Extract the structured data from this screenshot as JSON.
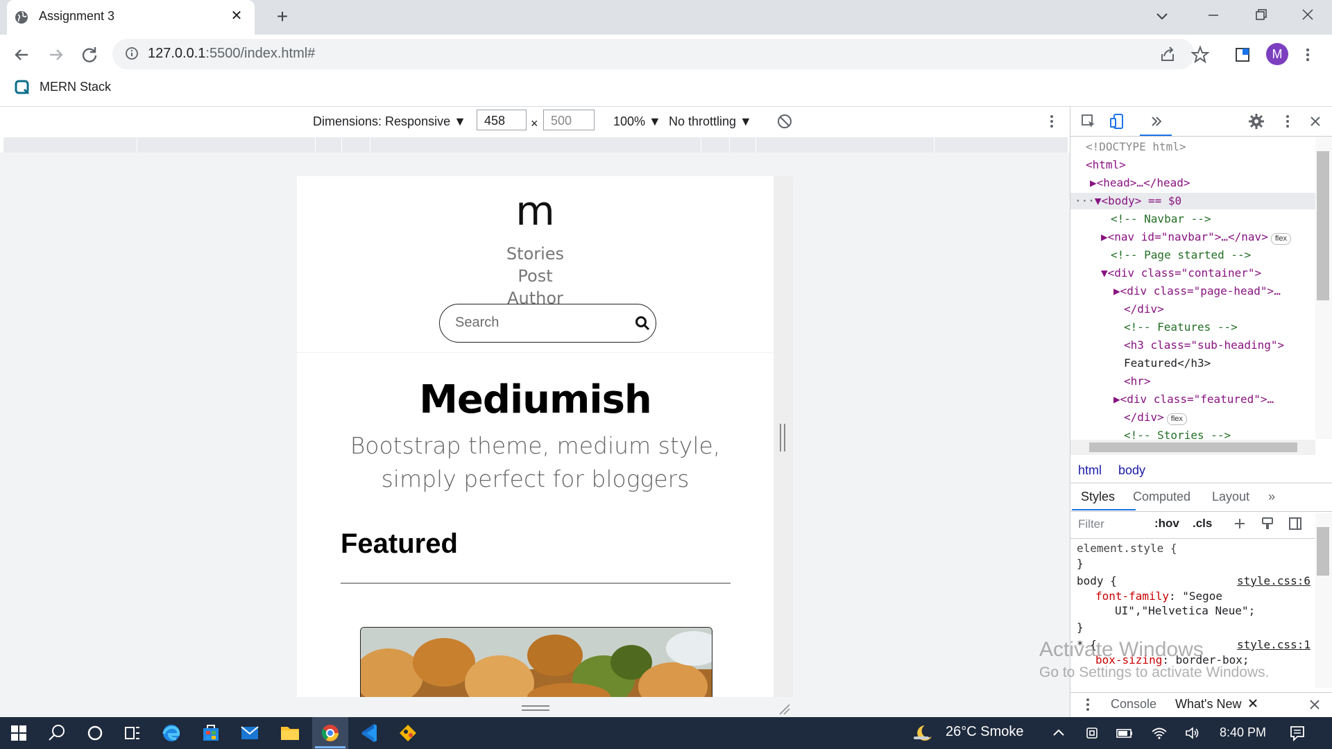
{
  "browser": {
    "tab_title": "Assignment 3",
    "tab_close": "✕",
    "new_tab": "+",
    "url_host": "127.0.0.1",
    "url_rest": ":5500/index.html#",
    "avatar_letter": "M",
    "bookmark_label": "MERN Stack"
  },
  "device_toolbar": {
    "dimensions_label": "Dimensions: Responsive ▼",
    "width_value": "458",
    "times": "×",
    "height_placeholder": "500",
    "zoom_label": "100% ▼",
    "throttle_label": "No throttling ▼"
  },
  "page": {
    "logo": "m",
    "nav_links": [
      "Stories",
      "Post",
      "Author"
    ],
    "search_placeholder": "Search",
    "site_title": "Mediumish",
    "tagline_1": "Bootstrap theme, medium style,",
    "tagline_2": "simply perfect for bloggers",
    "featured_heading": "Featured"
  },
  "devtools": {
    "elements": [
      {
        "t": "<!DOCTYPE html>"
      },
      {
        "t": "<html>"
      },
      {
        "t": "▶<head>…</head>"
      },
      {
        "t": "▼<body> == $0"
      },
      {
        "t": "<!-- Navbar -->"
      },
      {
        "t": "▶<nav id=\"navbar\">…</nav>"
      },
      {
        "t": "<!-- Page started -->"
      },
      {
        "t": "▼<div class=\"container\">"
      },
      {
        "t": "▶<div class=\"page-head\">…"
      },
      {
        "t": "</div>"
      },
      {
        "t": "<!-- Features -->"
      },
      {
        "t": "<h3 class=\"sub-heading\">"
      },
      {
        "t": "Featured</h3>"
      },
      {
        "t": "<hr>"
      },
      {
        "t": "▶<div class=\"featured\">…"
      },
      {
        "t": "</div>"
      },
      {
        "t": "<!-- Stories -->"
      }
    ],
    "badge_flex": "flex",
    "selected_eq": "== $0",
    "breadcrumbs": [
      "html",
      "body"
    ],
    "style_tabs": [
      "Styles",
      "Computed",
      "Layout",
      "»"
    ],
    "filter_placeholder": "Filter",
    "hov": ":hov",
    "cls": ".cls",
    "styles": {
      "element_style": "element.style {",
      "close_brace": "}",
      "body_selector": "body {",
      "body_source": "style.css:6",
      "body_prop": "font-family",
      "body_val_1": "\"Segoe",
      "body_val_2": "UI\",\"Helvetica Neue\";",
      "star_selector": "* {",
      "star_source": "style.css:1",
      "star_prop": "box-sizing",
      "star_val": "border-box;"
    },
    "drawer_tabs": [
      "Console",
      "What's New"
    ]
  },
  "watermark": {
    "line1": "Activate Windows",
    "line2": "Go to Settings to activate Windows."
  },
  "taskbar": {
    "weather": "26°C  Smoke",
    "time": "8:40 PM"
  }
}
